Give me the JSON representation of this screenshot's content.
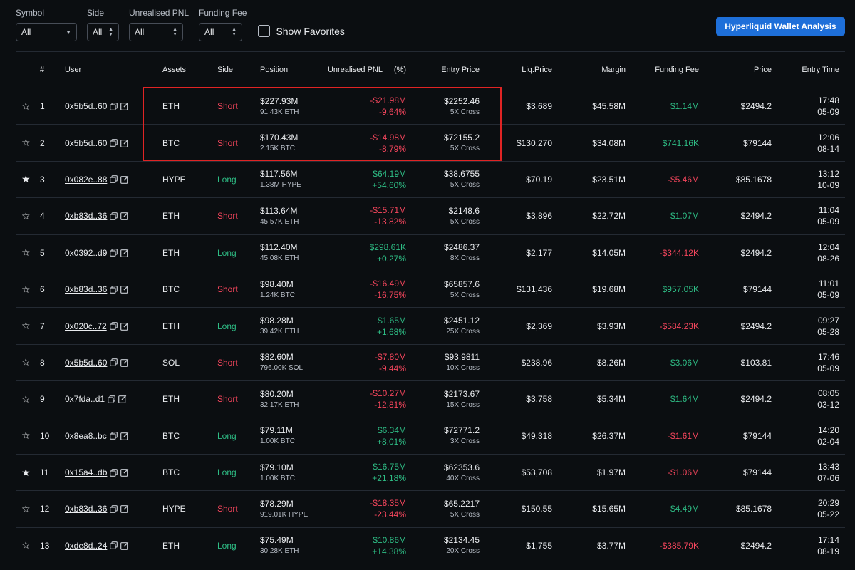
{
  "filters": {
    "symbol": {
      "label": "Symbol",
      "value": "All"
    },
    "side": {
      "label": "Side",
      "value": "All"
    },
    "pnl": {
      "label": "Unrealised PNL",
      "value": "All"
    },
    "funding": {
      "label": "Funding Fee",
      "value": "All"
    },
    "favorites_label": "Show Favorites"
  },
  "wallet_button": "Hyperliquid Wallet Analysis",
  "colors": {
    "accent": "#1e6fd9",
    "negative": "#f6465d",
    "positive": "#2ebd85",
    "highlight": "#e02424"
  },
  "headers": {
    "num": "#",
    "user": "User",
    "assets": "Assets",
    "side": "Side",
    "position": "Position",
    "pnl": "Unrealised PNL",
    "pct": "(%)",
    "entry": "Entry Price",
    "liq": "Liq.Price",
    "margin": "Margin",
    "funding": "Funding Fee",
    "price": "Price",
    "time": "Entry Time"
  },
  "rows": [
    {
      "num": "1",
      "fav": false,
      "user": "0x5b5d..60",
      "asset": "ETH",
      "side": "Short",
      "pos": "$227.93M",
      "qty": "91.43K ETH",
      "pnl": "-$21.98M",
      "pct": "-9.64%",
      "entry": "$2252.46",
      "lev": "5X Cross",
      "liq": "$3,689",
      "margin": "$45.58M",
      "fee": "$1.14M",
      "price": "$2494.2",
      "time": "17:48",
      "date": "05-09"
    },
    {
      "num": "2",
      "fav": false,
      "user": "0x5b5d..60",
      "asset": "BTC",
      "side": "Short",
      "pos": "$170.43M",
      "qty": "2.15K BTC",
      "pnl": "-$14.98M",
      "pct": "-8.79%",
      "entry": "$72155.2",
      "lev": "5X Cross",
      "liq": "$130,270",
      "margin": "$34.08M",
      "fee": "$741.16K",
      "price": "$79144",
      "time": "12:06",
      "date": "08-14"
    },
    {
      "num": "3",
      "fav": true,
      "user": "0x082e..88",
      "asset": "HYPE",
      "side": "Long",
      "pos": "$117.56M",
      "qty": "1.38M HYPE",
      "pnl": "$64.19M",
      "pct": "+54.60%",
      "entry": "$38.6755",
      "lev": "5X Cross",
      "liq": "$70.19",
      "margin": "$23.51M",
      "fee": "-$5.46M",
      "price": "$85.1678",
      "time": "13:12",
      "date": "10-09"
    },
    {
      "num": "4",
      "fav": false,
      "user": "0xb83d..36",
      "asset": "ETH",
      "side": "Short",
      "pos": "$113.64M",
      "qty": "45.57K ETH",
      "pnl": "-$15.71M",
      "pct": "-13.82%",
      "entry": "$2148.6",
      "lev": "5X Cross",
      "liq": "$3,896",
      "margin": "$22.72M",
      "fee": "$1.07M",
      "price": "$2494.2",
      "time": "11:04",
      "date": "05-09"
    },
    {
      "num": "5",
      "fav": false,
      "user": "0x0392..d9",
      "asset": "ETH",
      "side": "Long",
      "pos": "$112.40M",
      "qty": "45.08K ETH",
      "pnl": "$298.61K",
      "pct": "+0.27%",
      "entry": "$2486.37",
      "lev": "8X Cross",
      "liq": "$2,177",
      "margin": "$14.05M",
      "fee": "-$344.12K",
      "price": "$2494.2",
      "time": "12:04",
      "date": "08-26"
    },
    {
      "num": "6",
      "fav": false,
      "user": "0xb83d..36",
      "asset": "BTC",
      "side": "Short",
      "pos": "$98.40M",
      "qty": "1.24K BTC",
      "pnl": "-$16.49M",
      "pct": "-16.75%",
      "entry": "$65857.6",
      "lev": "5X Cross",
      "liq": "$131,436",
      "margin": "$19.68M",
      "fee": "$957.05K",
      "price": "$79144",
      "time": "11:01",
      "date": "05-09"
    },
    {
      "num": "7",
      "fav": false,
      "user": "0x020c..72",
      "asset": "ETH",
      "side": "Long",
      "pos": "$98.28M",
      "qty": "39.42K ETH",
      "pnl": "$1.65M",
      "pct": "+1.68%",
      "entry": "$2451.12",
      "lev": "25X Cross",
      "liq": "$2,369",
      "margin": "$3.93M",
      "fee": "-$584.23K",
      "price": "$2494.2",
      "time": "09:27",
      "date": "05-28"
    },
    {
      "num": "8",
      "fav": false,
      "user": "0x5b5d..60",
      "asset": "SOL",
      "side": "Short",
      "pos": "$82.60M",
      "qty": "796.00K SOL",
      "pnl": "-$7.80M",
      "pct": "-9.44%",
      "entry": "$93.9811",
      "lev": "10X Cross",
      "liq": "$238.96",
      "margin": "$8.26M",
      "fee": "$3.06M",
      "price": "$103.81",
      "time": "17:46",
      "date": "05-09"
    },
    {
      "num": "9",
      "fav": false,
      "user": "0x7fda..d1",
      "asset": "ETH",
      "side": "Short",
      "pos": "$80.20M",
      "qty": "32.17K ETH",
      "pnl": "-$10.27M",
      "pct": "-12.81%",
      "entry": "$2173.67",
      "lev": "15X Cross",
      "liq": "$3,758",
      "margin": "$5.34M",
      "fee": "$1.64M",
      "price": "$2494.2",
      "time": "08:05",
      "date": "03-12"
    },
    {
      "num": "10",
      "fav": false,
      "user": "0x8ea8..bc",
      "asset": "BTC",
      "side": "Long",
      "pos": "$79.11M",
      "qty": "1.00K BTC",
      "pnl": "$6.34M",
      "pct": "+8.01%",
      "entry": "$72771.2",
      "lev": "3X Cross",
      "liq": "$49,318",
      "margin": "$26.37M",
      "fee": "-$1.61M",
      "price": "$79144",
      "time": "14:20",
      "date": "02-04"
    },
    {
      "num": "11",
      "fav": true,
      "user": "0x15a4..db",
      "asset": "BTC",
      "side": "Long",
      "pos": "$79.10M",
      "qty": "1.00K BTC",
      "pnl": "$16.75M",
      "pct": "+21.18%",
      "entry": "$62353.6",
      "lev": "40X Cross",
      "liq": "$53,708",
      "margin": "$1.97M",
      "fee": "-$1.06M",
      "price": "$79144",
      "time": "13:43",
      "date": "07-06"
    },
    {
      "num": "12",
      "fav": false,
      "user": "0xb83d..36",
      "asset": "HYPE",
      "side": "Short",
      "pos": "$78.29M",
      "qty": "919.01K HYPE",
      "pnl": "-$18.35M",
      "pct": "-23.44%",
      "entry": "$65.2217",
      "lev": "5X Cross",
      "liq": "$150.55",
      "margin": "$15.65M",
      "fee": "$4.49M",
      "price": "$85.1678",
      "time": "20:29",
      "date": "05-22"
    },
    {
      "num": "13",
      "fav": false,
      "user": "0xde8d..24",
      "asset": "ETH",
      "side": "Long",
      "pos": "$75.49M",
      "qty": "30.28K ETH",
      "pnl": "$10.86M",
      "pct": "+14.38%",
      "entry": "$2134.45",
      "lev": "20X Cross",
      "liq": "$1,755",
      "margin": "$3.77M",
      "fee": "-$385.79K",
      "price": "$2494.2",
      "time": "17:14",
      "date": "08-19"
    }
  ]
}
